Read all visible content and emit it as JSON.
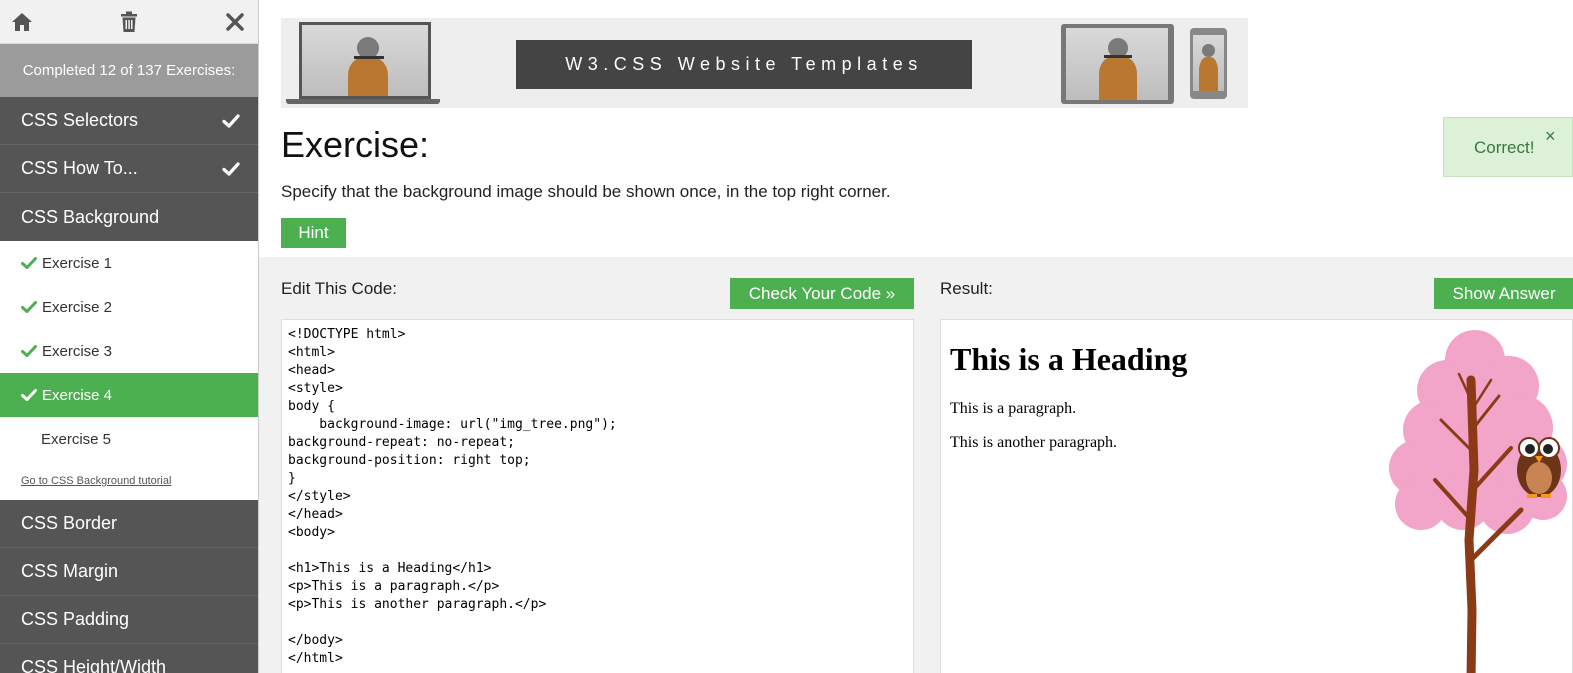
{
  "sidebar": {
    "progress": "Completed 12 of 137 Exercises:",
    "topics_done": [
      {
        "label": "CSS Selectors"
      },
      {
        "label": "CSS How To..."
      }
    ],
    "current_topic": "CSS Background",
    "exercises": [
      {
        "label": "Exercise 1"
      },
      {
        "label": "Exercise 2"
      },
      {
        "label": "Exercise 3"
      },
      {
        "label": "Exercise 4"
      },
      {
        "label": "Exercise 5"
      }
    ],
    "tutorial_link": "Go to CSS Background tutorial",
    "topics_after": [
      {
        "label": "CSS Border"
      },
      {
        "label": "CSS Margin"
      },
      {
        "label": "CSS Padding"
      },
      {
        "label": "CSS Height/Width"
      }
    ]
  },
  "banner": {
    "title": "W3.CSS Website Templates"
  },
  "exercise": {
    "title": "Exercise:",
    "instruction": "Specify that the background image should be shown once, in the top right corner.",
    "hint_label": "Hint"
  },
  "toast": {
    "message": "Correct!",
    "close": "×"
  },
  "editor": {
    "label": "Edit This Code:",
    "check_label": "Check Your Code »",
    "code_lines": [
      "<!DOCTYPE html>",
      "<html>",
      "<head>",
      "<style>",
      "body {",
      "    background-image: url(\"img_tree.png\");",
      "background-repeat: no-repeat;",
      "background-position: right top;",
      "}",
      "</style>",
      "</head>",
      "<body>",
      "",
      "<h1>This is a Heading</h1>",
      "<p>This is a paragraph.</p>",
      "<p>This is another paragraph.</p>",
      "",
      "</body>",
      "</html>"
    ]
  },
  "result": {
    "label": "Result:",
    "answer_label": "Show Answer",
    "heading": "This is a Heading",
    "paragraph1": "This is a paragraph.",
    "paragraph2": "This is another paragraph."
  },
  "colors": {
    "accent_green": "#4caf50",
    "sidebar_dark": "#555555",
    "success_bg": "#ddf0d8",
    "success_text": "#3c763d"
  },
  "icons": [
    "home-icon",
    "trash-icon",
    "close-icon",
    "check-icon"
  ]
}
